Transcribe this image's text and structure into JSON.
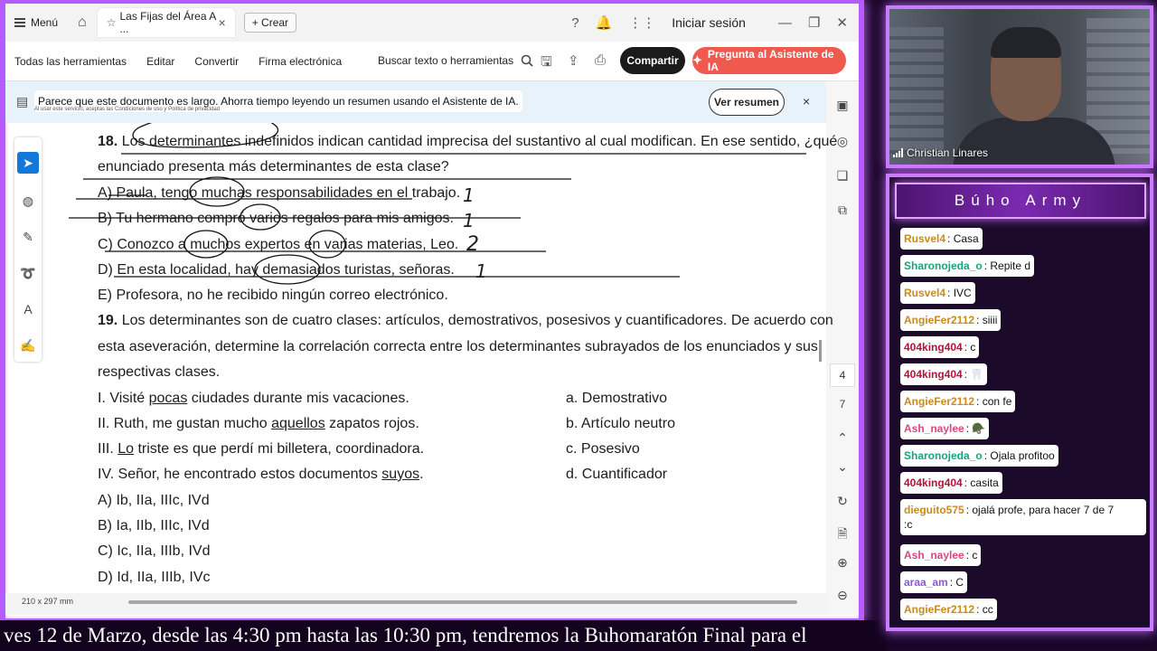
{
  "app": {
    "menu_label": "Menú",
    "tab_title": "Las Fijas del Área A ...",
    "create_label": "Crear",
    "signin_label": "Iniciar sesión"
  },
  "toolbar": {
    "all_tools": "Todas las herramientas",
    "edit": "Editar",
    "convert": "Convertir",
    "esign": "Firma electrónica",
    "search": "Buscar texto o herramientas",
    "share": "Compartir",
    "ai_assistant": "Pregunta al Asistente de IA"
  },
  "banner": {
    "message": "Parece que este documento es largo. Ahorra tiempo leyendo un resumen usando el Asistente de IA.",
    "fine_print": "Al usar este servicio, aceptas las Condiciones de uso y Política de privacidad",
    "button": "Ver resumen",
    "close": "×"
  },
  "document": {
    "q18_num": "18.",
    "q18_line1": "Los determinantes indefinidos indican cantidad imprecisa del sustantivo al cual modifican. En ese sentido, ¿qué",
    "q18_line2": "enunciado presenta más determinantes de esta clase?",
    "q18_options": [
      "A) Paula, tengo muchas responsabilidades en el trabajo.",
      "B) Tu hermano compró varios regalos para mis amigos.",
      "C) Conozco a muchos expertos en varias materias, Leo.",
      "D) En esta localidad, hay demasiados turistas, señoras.",
      "E) Profesora, no he recibido ningún correo electrónico."
    ],
    "q19_num": "19.",
    "q19_line1": "Los determinantes son de cuatro clases: artículos, demostrativos, posesivos y cuantificadores. De acuerdo con",
    "q19_line2": "esta aseveración, determine la correlación correcta entre los determinantes subrayados de los enunciados y sus",
    "q19_line3": "respectivas clases.",
    "q19_left": [
      {
        "pre": "I. Visité ",
        "u": "pocas",
        "post": " ciudades durante mis vacaciones."
      },
      {
        "pre": "II. Ruth, me gustan mucho ",
        "u": "aquellos",
        "post": " zapatos rojos."
      },
      {
        "pre": "III. ",
        "u": "Lo",
        "post": " triste es que perdí mi billetera, coordinadora."
      },
      {
        "pre": "IV. Señor, he encontrado estos documentos ",
        "u": "suyos",
        "post": "."
      }
    ],
    "q19_right": [
      "a. Demostrativo",
      "b. Artículo neutro",
      "c. Posesivo",
      "d. Cuantificador"
    ],
    "q19_options": [
      "A) Ib, IIa, IIIc, IVd",
      "B) Ia, IIb, IIIc, IVd",
      "C) Ic, IIa, IIIb, IVd",
      "D) Id, IIa, IIIb, IVc"
    ],
    "handwritten_counts": [
      "1",
      "1",
      "2",
      "1"
    ],
    "page_size": "210 x 297 mm",
    "page_numbers": [
      "4",
      "7"
    ]
  },
  "camera": {
    "name": "Christian Linares"
  },
  "chat": {
    "title": "Búho Army",
    "messages": [
      {
        "user": "Rusvel4",
        "text": "Casa",
        "color": "#c98a1e"
      },
      {
        "user": "Sharonojeda_o",
        "text": "Repite d",
        "color": "#1aa37a"
      },
      {
        "user": "Rusvel4",
        "text": "IVC",
        "color": "#c98a1e"
      },
      {
        "user": "AngieFer2112",
        "text": "siiii",
        "color": "#c98a1e"
      },
      {
        "user": "404king404",
        "text": "c",
        "color": "#b3123a"
      },
      {
        "user": "404king404",
        "text": "🦷",
        "color": "#b3123a"
      },
      {
        "user": "AngieFer2112",
        "text": "con fe",
        "color": "#c98a1e"
      },
      {
        "user": "Ash_naylee",
        "text": "🪖",
        "color": "#d9477b"
      },
      {
        "user": "Sharonojeda_o",
        "text": "Ojala profitoo",
        "color": "#1aa37a"
      },
      {
        "user": "404king404",
        "text": "casita",
        "color": "#b3123a"
      },
      {
        "user": "dieguito575",
        "text": "ojalá profe, para hacer 7 de 7",
        "text2": ":c",
        "color": "#c98a1e"
      },
      {
        "user": "Ash_naylee",
        "text": "c",
        "color": "#d9477b"
      },
      {
        "user": "araa_am",
        "text": "C",
        "color": "#8a5cc7"
      },
      {
        "user": "AngieFer2112",
        "text": "cc",
        "color": "#c98a1e"
      }
    ]
  },
  "ticker": {
    "text": "ves 12 de Marzo, desde las 4:30 pm hasta las 10:30 pm, tendremos la Buhomaratón Final para el"
  }
}
